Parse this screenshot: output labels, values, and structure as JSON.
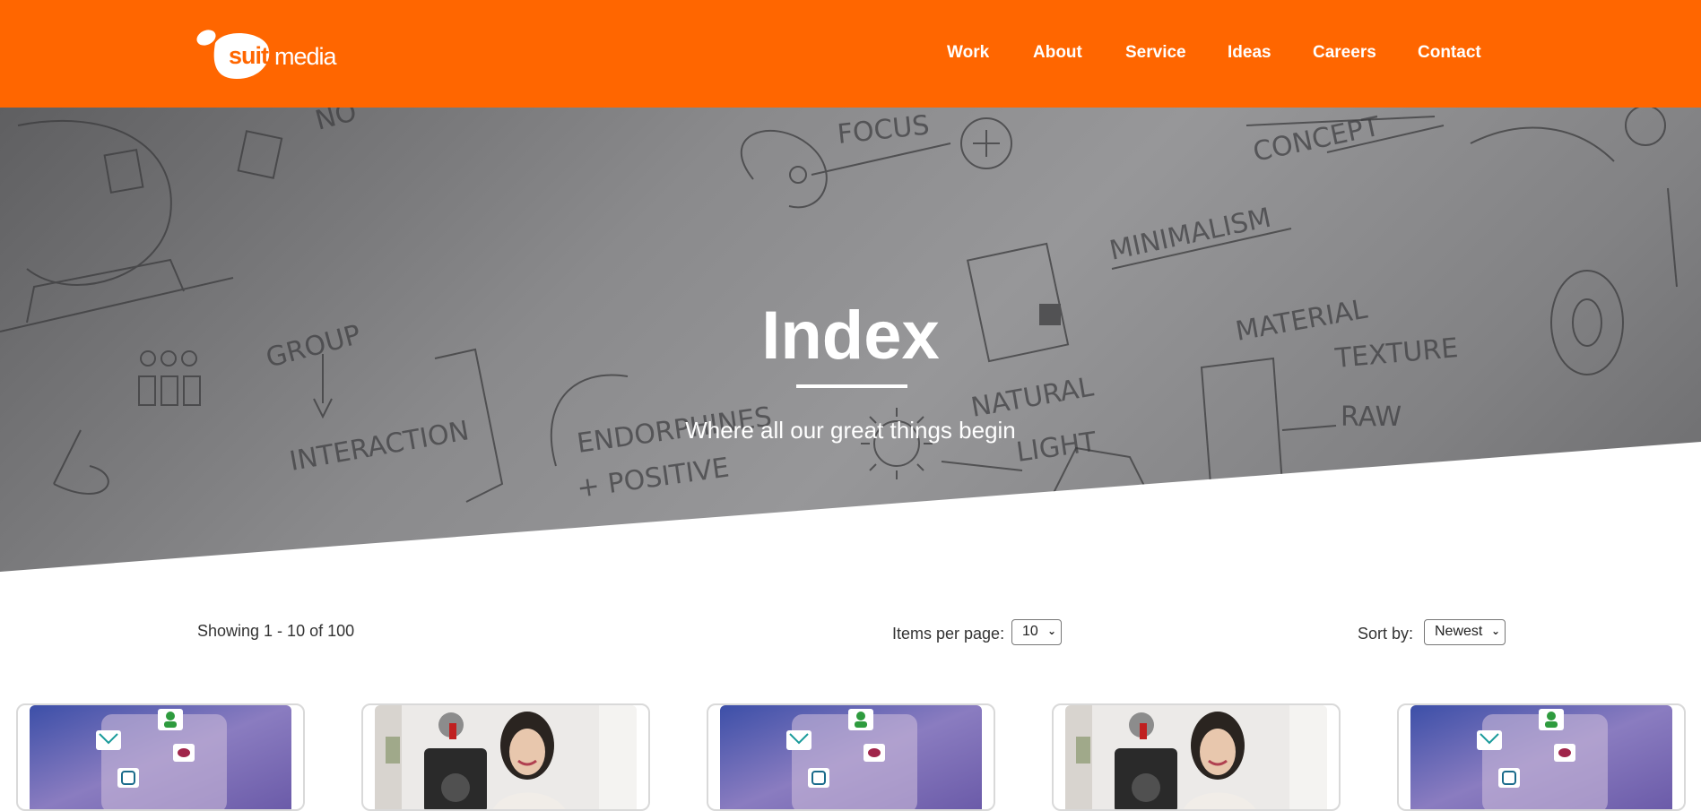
{
  "brand": {
    "logo_text_a": "suit",
    "logo_text_b": "media",
    "color": "#ff6600"
  },
  "nav": {
    "items": [
      {
        "label": "Work"
      },
      {
        "label": "About"
      },
      {
        "label": "Service"
      },
      {
        "label": "Ideas"
      },
      {
        "label": "Careers"
      },
      {
        "label": "Contact"
      }
    ]
  },
  "hero": {
    "title": "Index",
    "subtitle": "Where all our great things begin",
    "sketch_words": [
      "FOCUS",
      "CONCEPT",
      "MINIMALISM",
      "MATERIAL",
      "TEXTURE",
      "RAW",
      "NATURAL",
      "LIGHT",
      "ENDORPHINES",
      "+ POSITIVE",
      "INTERACTION",
      "GROUP",
      "NO"
    ]
  },
  "listing": {
    "showing_text": "Showing 1 - 10 of 100",
    "items_per_page_label": "Items per page:",
    "items_per_page_value": "10",
    "sort_label": "Sort by:",
    "sort_value": "Newest"
  },
  "cards": [
    {
      "image": "social-media-icons-photo"
    },
    {
      "image": "woman-vlogger-camera-photo"
    },
    {
      "image": "social-media-icons-photo"
    },
    {
      "image": "woman-vlogger-camera-photo"
    },
    {
      "image": "social-media-icons-photo"
    }
  ]
}
